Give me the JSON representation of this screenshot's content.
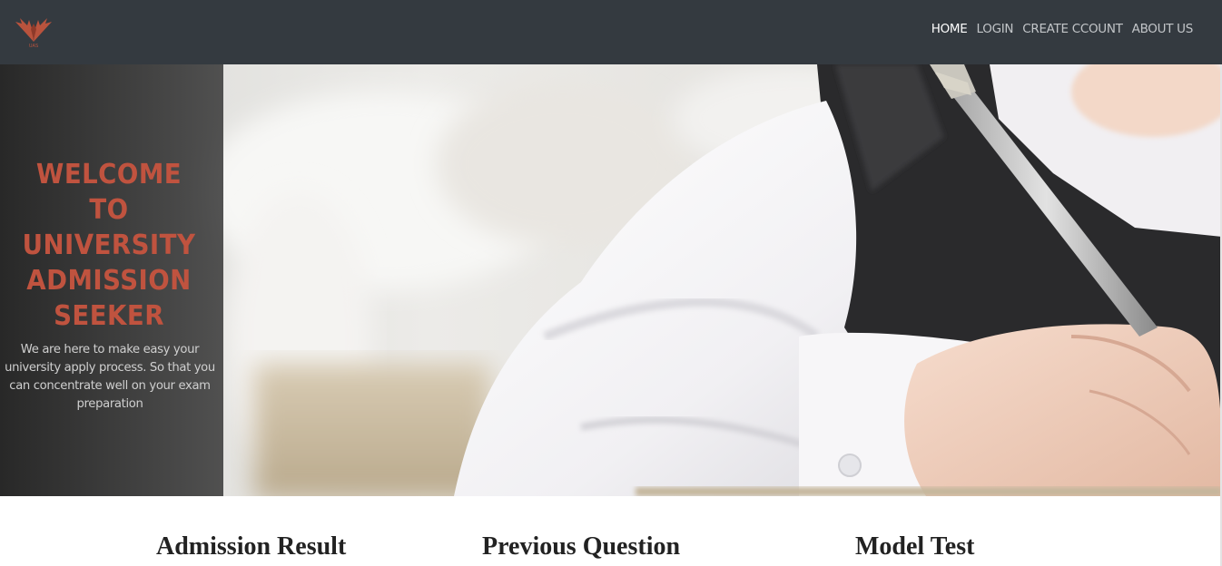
{
  "nav": {
    "logo_icon": "phoenix-logo-icon",
    "logo_text": "UAS",
    "links": [
      {
        "label": "HOME",
        "active": true
      },
      {
        "label": "LOGIN",
        "active": false
      },
      {
        "label": "CREATE CCOUNT",
        "active": false
      },
      {
        "label": "ABOUT US",
        "active": false
      }
    ]
  },
  "hero": {
    "title_lines": [
      "WELCOME",
      "TO",
      "UNIVERSITY",
      "ADMISSION",
      "SEEKER"
    ],
    "subtitle": "We are here to make easy your university apply process. So that you can concentrate well on your exam preparation",
    "title_color": "#c0533f",
    "image": "student-writing-exam-photo"
  },
  "services": [
    {
      "label": "Admission Result"
    },
    {
      "label": "Previous Question"
    },
    {
      "label": "Model Test"
    }
  ],
  "colors": {
    "navbar": "#343a40",
    "accent": "#c0533f"
  }
}
